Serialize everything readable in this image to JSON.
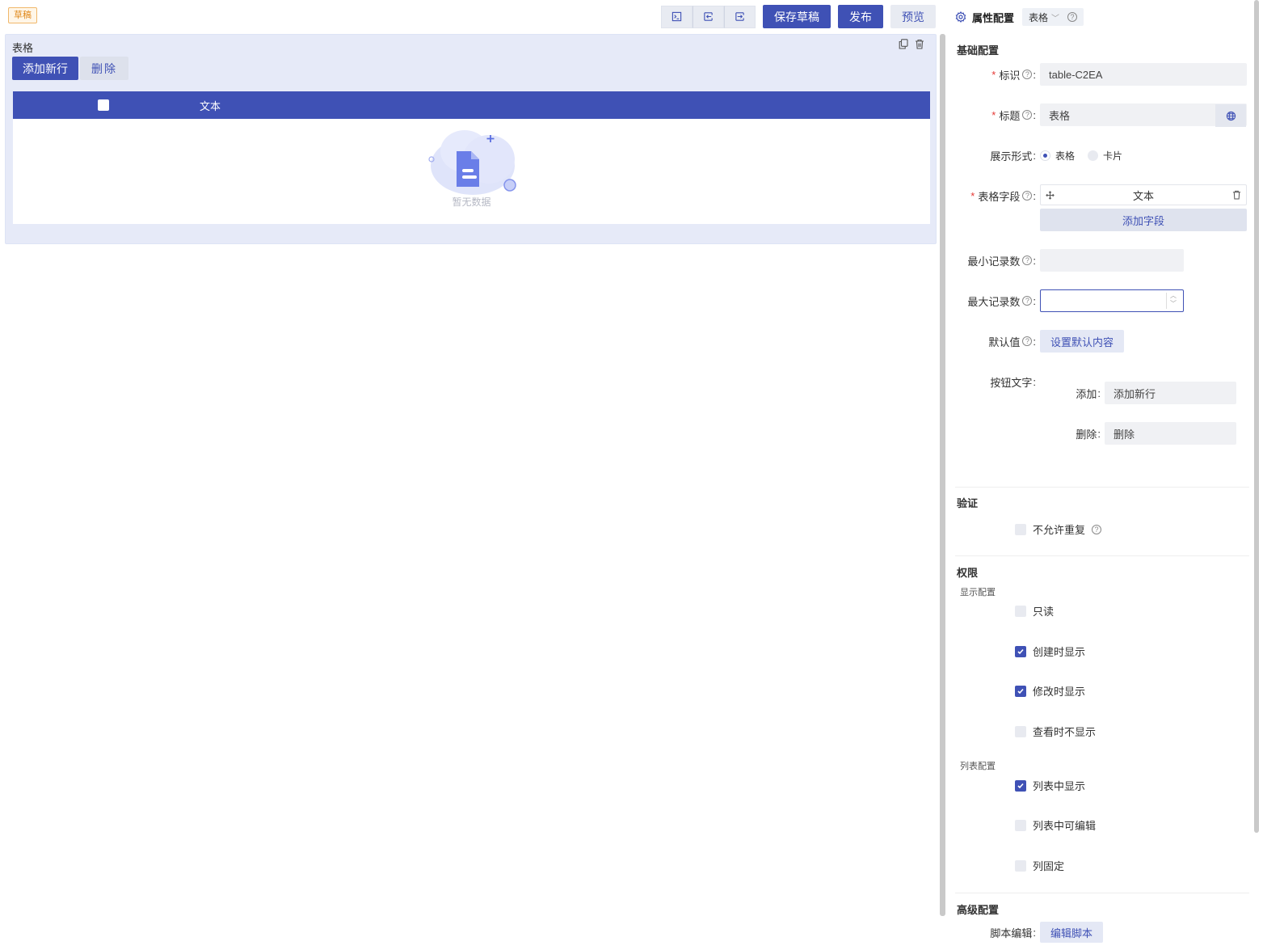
{
  "toolbar": {
    "draft_badge": "草稿",
    "icons": [
      "terminal-icon",
      "indent-icon",
      "outdent-icon"
    ],
    "save_draft": "保存草稿",
    "publish": "发布",
    "preview": "预览"
  },
  "canvas": {
    "block_label": "表格",
    "add_row": "添加新行",
    "delete": "删除",
    "column_header": "文本",
    "empty_text": "暂无数据"
  },
  "panel": {
    "title": "属性配置",
    "component_type": "表格",
    "basic": {
      "section": "基础配置",
      "id_label": "标识",
      "id_value": "table-C2EA",
      "title_label": "标题",
      "title_value": "表格",
      "display_label": "展示形式",
      "display_options": [
        "表格",
        "卡片"
      ],
      "display_selected": "表格",
      "fields_label": "表格字段",
      "field_item": "文本",
      "add_field": "添加字段",
      "min_label": "最小记录数",
      "min_value": "",
      "max_label": "最大记录数",
      "max_value": "",
      "default_label": "默认值",
      "default_button": "设置默认内容",
      "btn_text_label": "按钮文字",
      "add_label": "添加",
      "add_value": "添加新行",
      "del_label": "删除",
      "del_value": "删除"
    },
    "validation": {
      "section": "验证",
      "no_duplicate": "不允许重复",
      "no_duplicate_checked": false
    },
    "permission": {
      "section": "权限",
      "display_config": "显示配置",
      "readonly": "只读",
      "show_on_create": "创建时显示",
      "show_on_edit": "修改时显示",
      "hide_on_view": "查看时不显示",
      "list_config": "列表配置",
      "show_in_list": "列表中显示",
      "editable_in_list": "列表中可编辑",
      "fixed_column": "列固定"
    },
    "advanced": {
      "section": "高级配置",
      "script_label": "脚本编辑",
      "script_button": "编辑脚本"
    }
  },
  "colors": {
    "primary": "#3f51b5",
    "canvas_block": "#e6eaf8",
    "draft_orange": "#e08a1e"
  }
}
